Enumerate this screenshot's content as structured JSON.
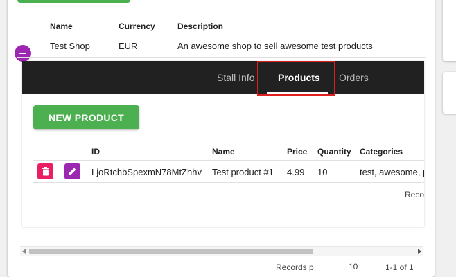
{
  "shop_table": {
    "headers": [
      "Name",
      "Currency",
      "Description"
    ],
    "row": {
      "name": "Test Shop",
      "currency": "EUR",
      "description": "An awesome shop to sell awesome test products"
    }
  },
  "tabs": [
    {
      "label": "Stall Info",
      "active": false
    },
    {
      "label": "Products",
      "active": true
    },
    {
      "label": "Orders",
      "active": false
    }
  ],
  "new_product_label": "NEW PRODUCT",
  "products_table": {
    "headers": [
      "ID",
      "Name",
      "Price",
      "Quantity",
      "Categories"
    ],
    "rows": [
      {
        "id": "LjoRtchbSpexmN78MtZhhv",
        "name": "Test product #1",
        "price": "4.99",
        "quantity": "10",
        "categories": "test, awesome, p"
      }
    ]
  },
  "pager": {
    "records_label_partial": "Reco",
    "bottom_rows_label_partial": "Records p",
    "bottom_rows_value_partial": "10",
    "bottom_range_partial": "1-1 of 1"
  },
  "icons": {
    "minus": "minus-icon",
    "delete": "trash-icon",
    "edit": "pencil-icon"
  },
  "colors": {
    "green": "#4caf50",
    "purple": "#9c27b0",
    "pink": "#e91e63",
    "tabbar": "#212121",
    "highlight": "#e0201f"
  }
}
